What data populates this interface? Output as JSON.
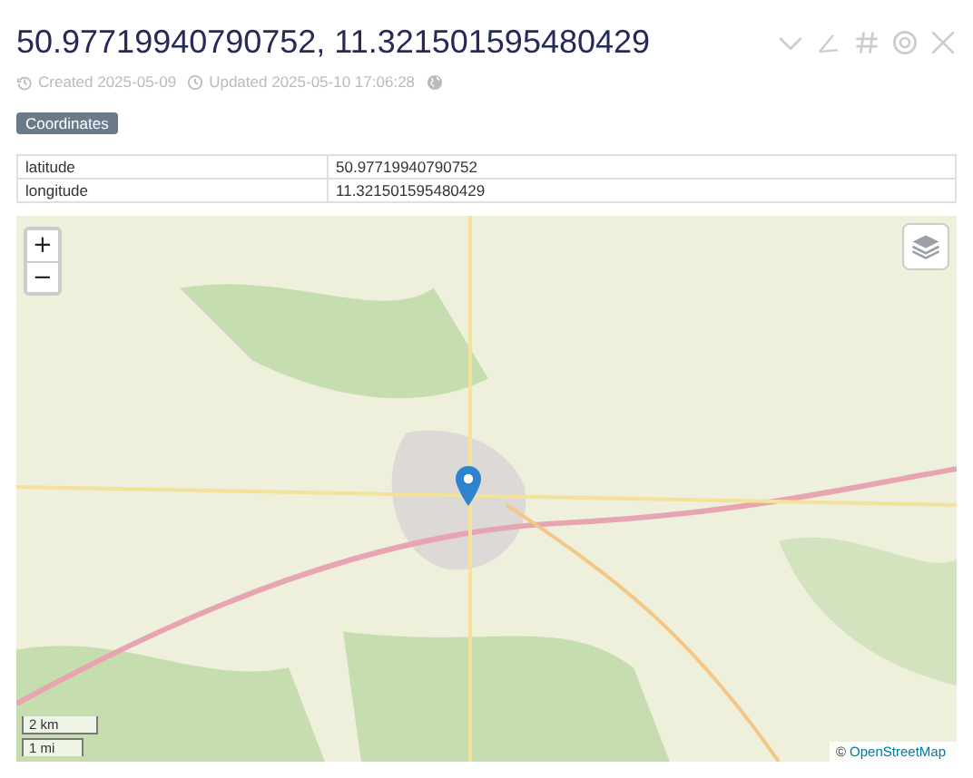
{
  "title": "50.97719940790752, 11.321501595480429",
  "actions": [
    {
      "kind": "chevron"
    },
    {
      "kind": "pen"
    },
    {
      "kind": "hash"
    },
    {
      "kind": "target"
    },
    {
      "kind": "close"
    }
  ],
  "meta": {
    "created": "Created 2025-05-09",
    "updated": "Updated 2025-05-10 17:06:28"
  },
  "badge": "Coordinates",
  "table": {
    "rows": [
      [
        "latitude",
        "50.97719940790752"
      ],
      [
        "longitude",
        "11.321501595480429"
      ]
    ]
  },
  "map": {
    "zoom_in": "+",
    "zoom_out": "−",
    "scale": [
      "2 km",
      "1 mi"
    ],
    "attribution_symbol": "©",
    "attribution_link": "OpenStreetMap"
  }
}
